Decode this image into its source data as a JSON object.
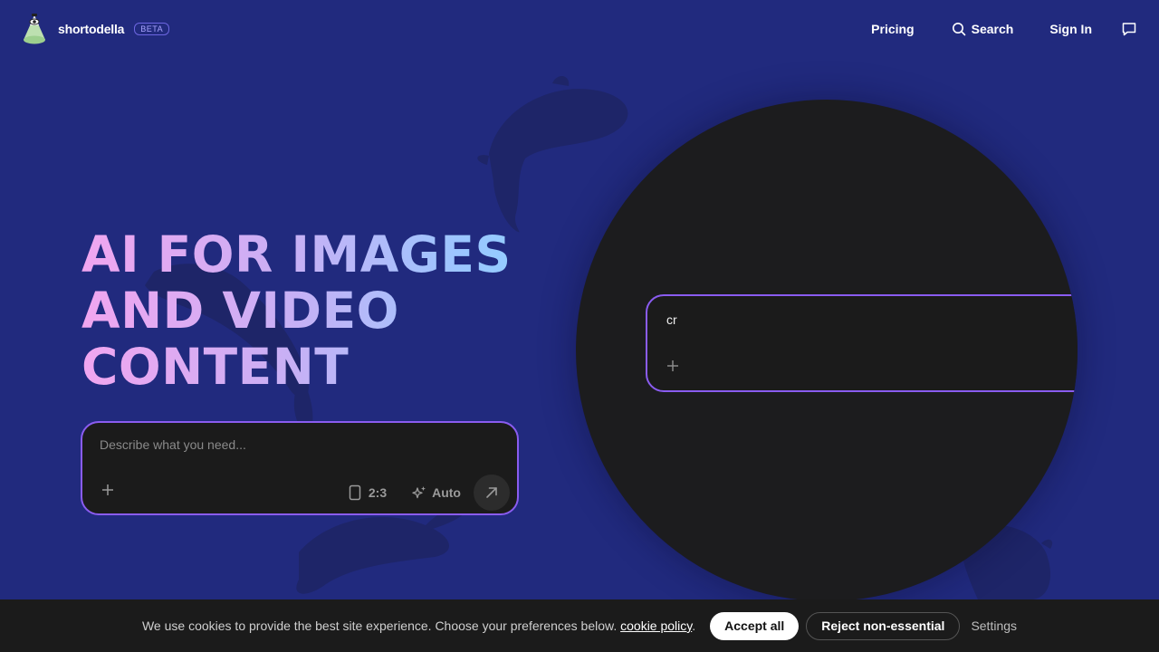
{
  "header": {
    "brand_name": "shortodella",
    "beta_label": "BETA",
    "nav": {
      "pricing": "Pricing",
      "search": "Search",
      "sign_in": "Sign In"
    },
    "icons": {
      "search": "search-icon",
      "chat": "chat-icon",
      "logo": "logo-icon"
    }
  },
  "hero": {
    "title_lines": [
      "AI FOR IMAGES",
      "AND VIDEO",
      "CONTENT"
    ]
  },
  "prompt": {
    "placeholder": "Describe what you need...",
    "aspect_ratio": "2:3",
    "model": "Auto",
    "icons": {
      "add": "plus-icon",
      "ratio": "portrait-frame-icon",
      "model": "sparkle-icon",
      "submit": "arrow-up-right-icon"
    }
  },
  "preview": {
    "typed_text": "cr",
    "icons": {
      "add": "plus-icon"
    }
  },
  "cookie": {
    "text": "We use cookies to provide the best site experience. Choose your preferences below.",
    "link_label": "cookie policy",
    "period": ".",
    "accept_label": "Accept all",
    "reject_label": "Reject non-essential",
    "settings_label": "Settings"
  },
  "colors": {
    "background": "#212a7e",
    "accent_border": "#8a5cf0",
    "panel": "#1b1b1b"
  }
}
